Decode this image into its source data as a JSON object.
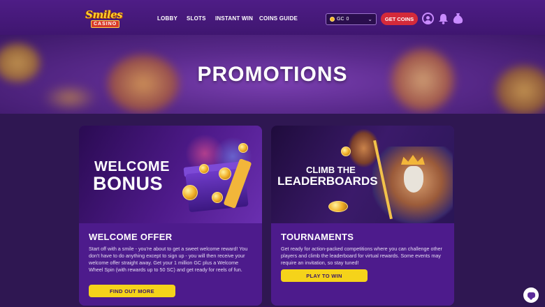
{
  "header": {
    "logo_top": "Smiles",
    "logo_bottom": "CASINO",
    "nav": [
      "LOBBY",
      "SLOTS",
      "INSTANT WIN",
      "COINS GUIDE"
    ],
    "currency_label": "GC",
    "currency_value": "0",
    "get_coins_label": "GET COINS"
  },
  "hero": {
    "title": "PROMOTIONS"
  },
  "cards": [
    {
      "banner_line1": "WELCOME",
      "banner_line2": "BONUS",
      "title": "WELCOME OFFER",
      "text": "Start off with a smile - you're about to get a sweet welcome reward! You don't have to do anything except to sign up - you will then receive your welcome offer straight away. Get your 1 million GC plus a Welcome Wheel Spin (with rewards up to 50 SC) and get ready for reels of fun.",
      "button": "FIND OUT MORE"
    },
    {
      "banner_line1": "CLIMB THE",
      "banner_line2": "LEADERBOARDS",
      "title": "TOURNAMENTS",
      "text": "Get ready for action-packed competitions where you can challenge other players and climb the leaderboard for virtual rewards. Some events may require an invitation, so stay tuned!",
      "button": "PLAY TO WIN"
    }
  ],
  "colors": {
    "background": "#2f1752",
    "nav_bg": "#4e1d86",
    "card_bg": "#4d1b8c",
    "cta_yellow": "#f5d31a",
    "get_coins_red": "#d42a3a",
    "icon_purple": "#c98bff"
  },
  "icons": [
    "user-icon",
    "bell-icon",
    "money-bag-icon",
    "coin-icon",
    "chevron-down-icon",
    "chat-icon"
  ]
}
